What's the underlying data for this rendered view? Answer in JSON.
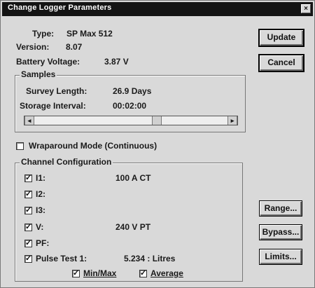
{
  "window": {
    "title": "Change Logger Parameters",
    "close_glyph": "×"
  },
  "info": {
    "type_label": "Type:",
    "type_value": "SP Max 512",
    "version_label": "Version:",
    "version_value": "8.07",
    "battery_label": "Battery Voltage:",
    "battery_value": "3.87 V"
  },
  "samples": {
    "legend": "Samples",
    "survey_label": "Survey Length:",
    "survey_value": "26.9 Days",
    "interval_label": "Storage Interval:",
    "interval_value": "00:02:00",
    "scroll_left": "◂",
    "scroll_right": "▸"
  },
  "wraparound": {
    "label": "Wraparound Mode (Continuous)",
    "checked": false
  },
  "channels": {
    "legend": "Channel Configuration",
    "items": [
      {
        "label": "I1:",
        "value": "100 A CT",
        "checked": true
      },
      {
        "label": "I2:",
        "value": "",
        "checked": true
      },
      {
        "label": "I3:",
        "value": "",
        "checked": true
      },
      {
        "label": "V:",
        "value": "240 V PT",
        "checked": true
      },
      {
        "label": "PF:",
        "value": "",
        "checked": true
      },
      {
        "label": "Pulse Test 1:",
        "value": "5.234 : Litres",
        "checked": true
      }
    ],
    "minmax_label": "Min/Max",
    "average_label": "Average"
  },
  "buttons": {
    "update": "Update",
    "cancel": "Cancel",
    "range": "Range...",
    "bypass": "Bypass...",
    "limits": "Limits..."
  }
}
